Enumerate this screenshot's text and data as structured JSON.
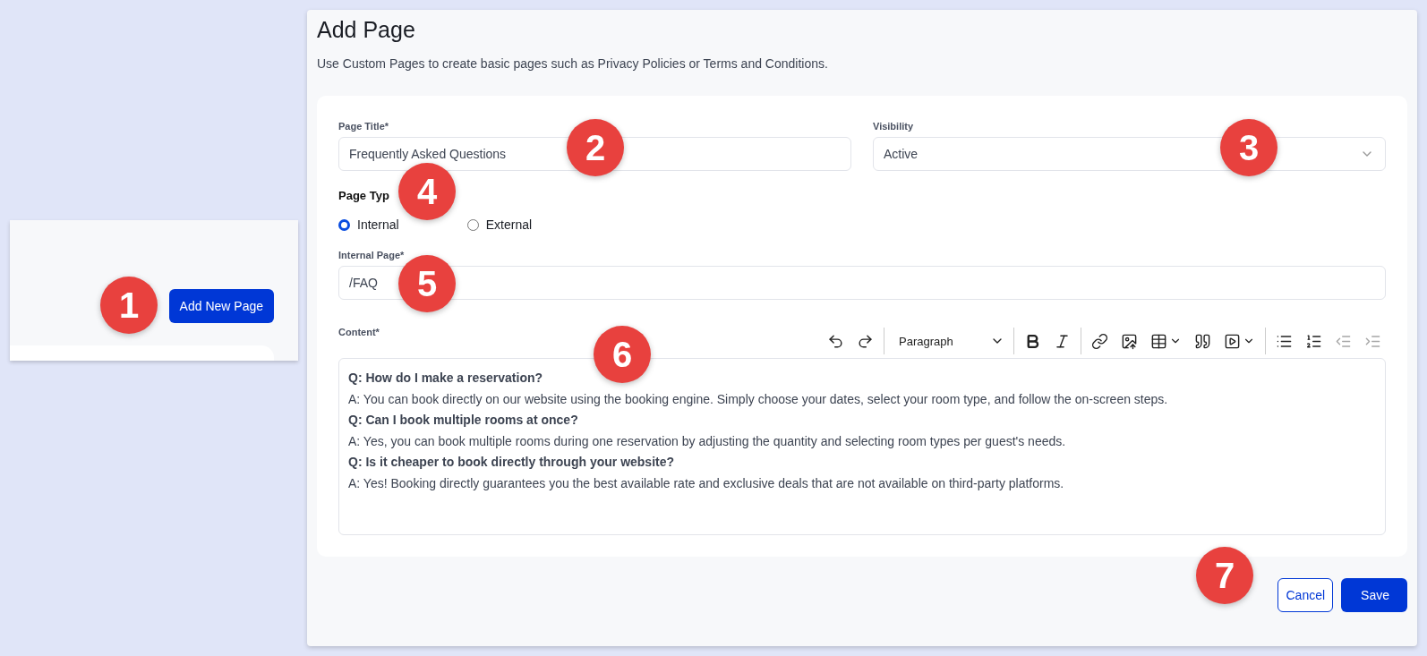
{
  "side_card": {
    "button": "Add New Page"
  },
  "page": {
    "title": "Add Page",
    "subtitle": "Use Custom Pages to create basic pages such as Privacy Policies or Terms and Conditions."
  },
  "form": {
    "page_title": {
      "label": "Page Title*",
      "value": "Frequently Asked Questions"
    },
    "visibility": {
      "label": "Visibility",
      "value": "Active"
    },
    "page_type": {
      "label": "Page Typ",
      "options": [
        {
          "label": "Internal",
          "selected": true
        },
        {
          "label": "External",
          "selected": false
        }
      ]
    },
    "internal_page": {
      "label": "Internal Page*",
      "value": "/FAQ"
    },
    "content": {
      "label": "Content*",
      "block_format": "Paragraph",
      "tools": [
        {
          "kind": "undo",
          "disabled": false
        },
        {
          "kind": "redo",
          "disabled": false
        },
        {
          "kind": "format"
        },
        {
          "kind": "bold",
          "disabled": false
        },
        {
          "kind": "italic",
          "disabled": false
        },
        {
          "kind": "link",
          "disabled": false
        },
        {
          "kind": "image",
          "disabled": false
        },
        {
          "kind": "table",
          "disabled": false
        },
        {
          "kind": "quote",
          "disabled": false
        },
        {
          "kind": "media",
          "disabled": false
        },
        {
          "kind": "bullets",
          "disabled": false
        },
        {
          "kind": "numbers",
          "disabled": false
        },
        {
          "kind": "outdent",
          "disabled": true
        },
        {
          "kind": "indent",
          "disabled": true
        }
      ],
      "lines": [
        {
          "kind": "question",
          "text": "Q: How do I make a reservation?"
        },
        {
          "kind": "answer",
          "text": "A: You can book directly on our website using the booking engine. Simply choose your dates, select your room type, and follow the on-screen steps."
        },
        {
          "kind": "question",
          "text": "Q: Can I book multiple rooms at once?"
        },
        {
          "kind": "answer",
          "text": "A: Yes, you can book multiple rooms during one reservation by adjusting the quantity and selecting room types per guest's needs."
        },
        {
          "kind": "question",
          "text": "Q: Is it cheaper to book directly through your website?"
        },
        {
          "kind": "answer",
          "text": "A: Yes! Booking directly guarantees you the best available rate and exclusive deals that are not available on third-party platforms."
        }
      ]
    }
  },
  "actions": {
    "cancel": "Cancel",
    "save": "Save"
  },
  "step_badges": [
    "1",
    "2",
    "3",
    "4",
    "5",
    "6",
    "7"
  ]
}
